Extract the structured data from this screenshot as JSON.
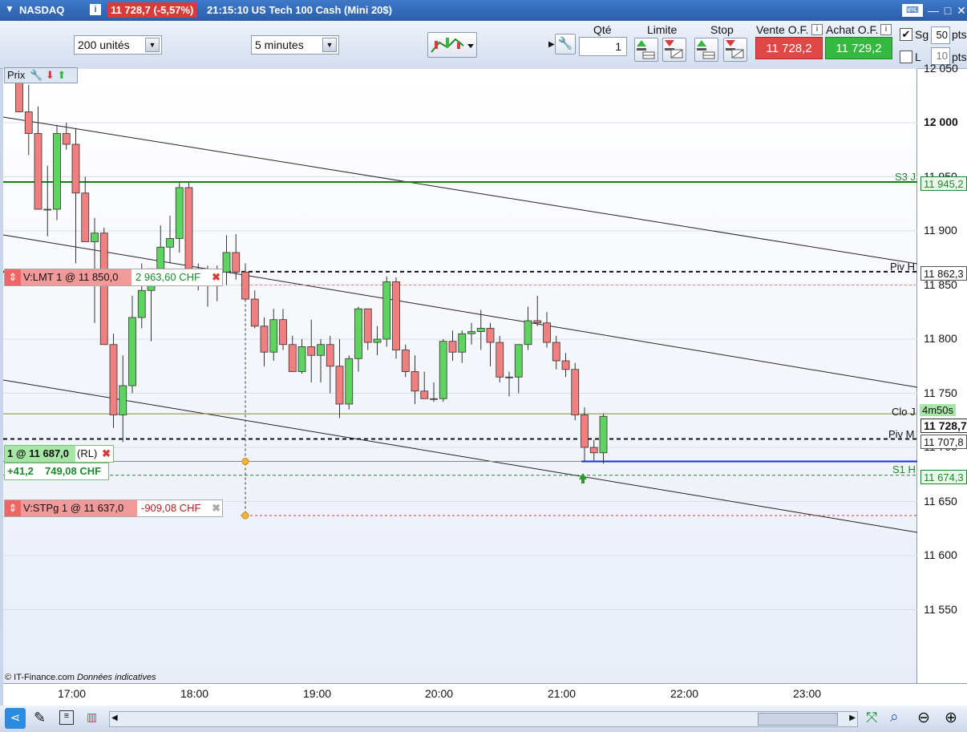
{
  "titlebar": {
    "instrument": "NASDAQ",
    "info_icon": "i",
    "price": "11 728,7 (-5,57%)",
    "description": "21:15:10 US Tech 100 Cash (Mini 20$)"
  },
  "toolbar": {
    "quantity_select": "200 unités",
    "interval_select": "5 minutes",
    "qty_label": "Qté",
    "qty_value": "1",
    "limit_label": "Limite",
    "stop_label": "Stop",
    "sell_label": "Vente O.F.",
    "buy_label": "Achat O.F.",
    "sell_price": "11 728,2",
    "buy_price": "11 729,2",
    "sg_label": "Sg",
    "sg_value": "50",
    "pts_label": "pts",
    "l_label": "L",
    "l_value": "10",
    "pts_label2": "pts"
  },
  "chart": {
    "price_tag": "Prix",
    "copyright": "© IT-Finance.com",
    "disclaimer": "Données indicatives",
    "order_limit": {
      "label": "V:LMT  1 @ 11 850,0",
      "value": "2 963,60 CHF"
    },
    "position": {
      "label": "1 @ 11 687,0",
      "mode": "(RL)",
      "pts": "+41,2",
      "value": "749,08 CHF"
    },
    "order_stop": {
      "label": "V:STPg  1 @ 11 637,0",
      "value": "-909,08 CHF"
    },
    "level_labels": {
      "s3": "S3 J",
      "pivh": "Piv H",
      "clo": "Clo J",
      "timer": "4m50s",
      "pivm": "Piv M",
      "s1": "S1 H"
    },
    "axis_tags": {
      "s3": "11 945,2",
      "pivh": "11 862,3",
      "last": "11 728,7",
      "pivm": "11 707,8",
      "s1": "11 674,3"
    },
    "y_ticks": [
      "12 050",
      "12 000",
      "11 950",
      "11 900",
      "11 850",
      "11 800",
      "11 750",
      "11 700",
      "11 650",
      "11 600",
      "11 550"
    ],
    "x_ticks": [
      "17:00",
      "18:00",
      "19:00",
      "20:00",
      "21:00",
      "22:00",
      "23:00"
    ]
  },
  "chart_data": {
    "type": "candlestick",
    "instrument": "NASDAQ",
    "ylim": [
      11490,
      12060
    ],
    "levels": {
      "S3 J": 11945.2,
      "Piv H": 11862.3,
      "Clo J": 11731,
      "Piv M": 11707.8,
      "S1 H": 11674.3,
      "limit_order": 11850.0,
      "entry": 11687.0,
      "stop_order": 11637.0,
      "last": 11728.7
    },
    "candles": [
      [
        12043,
        12050,
        12010,
        12010
      ],
      [
        12010,
        12035,
        11970,
        11990
      ],
      [
        11990,
        12015,
        11940,
        11920
      ],
      [
        11920,
        11960,
        11895,
        11920
      ],
      [
        11920,
        11998,
        11910,
        11990
      ],
      [
        11990,
        12000,
        11975,
        11980
      ],
      [
        11980,
        11995,
        11870,
        11935
      ],
      [
        11935,
        11950,
        11895,
        11890
      ],
      [
        11890,
        11912,
        11815,
        11898
      ],
      [
        11898,
        11903,
        11795,
        11795
      ],
      [
        11795,
        11805,
        11718,
        11730
      ],
      [
        11730,
        11785,
        11705,
        11757
      ],
      [
        11757,
        11840,
        11750,
        11820
      ],
      [
        11820,
        11870,
        11810,
        11845
      ],
      [
        11845,
        11862,
        11798,
        11865
      ],
      [
        11865,
        11905,
        11857,
        11885
      ],
      [
        11885,
        11914,
        11870,
        11893
      ],
      [
        11893,
        11945,
        11880,
        11940
      ],
      [
        11940,
        11945,
        11860,
        11865
      ],
      [
        11865,
        11870,
        11845,
        11860
      ],
      [
        11860,
        11868,
        11830,
        11863
      ],
      [
        11863,
        11868,
        11835,
        11862
      ],
      [
        11862,
        11896,
        11850,
        11880
      ],
      [
        11880,
        11897,
        11855,
        11862
      ],
      [
        11862,
        11870,
        11835,
        11837
      ],
      [
        11837,
        11845,
        11810,
        11812
      ],
      [
        11812,
        11820,
        11775,
        11788
      ],
      [
        11788,
        11828,
        11780,
        11818
      ],
      [
        11818,
        11828,
        11790,
        11795
      ],
      [
        11795,
        11803,
        11770,
        11770
      ],
      [
        11770,
        11800,
        11768,
        11793
      ],
      [
        11793,
        11818,
        11760,
        11785
      ],
      [
        11785,
        11800,
        11760,
        11795
      ],
      [
        11795,
        11803,
        11750,
        11775
      ],
      [
        11775,
        11800,
        11727,
        11740
      ],
      [
        11740,
        11785,
        11735,
        11782
      ],
      [
        11782,
        11830,
        11770,
        11828
      ],
      [
        11828,
        11822,
        11790,
        11797
      ],
      [
        11797,
        11812,
        11785,
        11800
      ],
      [
        11800,
        11858,
        11793,
        11853
      ],
      [
        11853,
        11857,
        11782,
        11790
      ],
      [
        11790,
        11795,
        11765,
        11770
      ],
      [
        11770,
        11785,
        11740,
        11752
      ],
      [
        11752,
        11770,
        11745,
        11745
      ],
      [
        11745,
        11760,
        11742,
        11745
      ],
      [
        11745,
        11800,
        11742,
        11798
      ],
      [
        11798,
        11808,
        11780,
        11788
      ],
      [
        11788,
        11808,
        11778,
        11805
      ],
      [
        11805,
        11815,
        11795,
        11807
      ],
      [
        11807,
        11827,
        11790,
        11810
      ],
      [
        11810,
        11815,
        11775,
        11797
      ],
      [
        11797,
        11803,
        11760,
        11765
      ],
      [
        11765,
        11770,
        11747,
        11765
      ],
      [
        11765,
        11795,
        11750,
        11795
      ],
      [
        11795,
        11830,
        11790,
        11817
      ],
      [
        11817,
        11840,
        11812,
        11815
      ],
      [
        11815,
        11825,
        11792,
        11797
      ],
      [
        11797,
        11803,
        11772,
        11780
      ],
      [
        11780,
        11787,
        11765,
        11772
      ],
      [
        11772,
        11778,
        11725,
        11730
      ],
      [
        11730,
        11737,
        11687,
        11700
      ],
      [
        11700,
        11707,
        11688,
        11695
      ],
      [
        11695,
        11731,
        11685,
        11728.7
      ]
    ]
  }
}
